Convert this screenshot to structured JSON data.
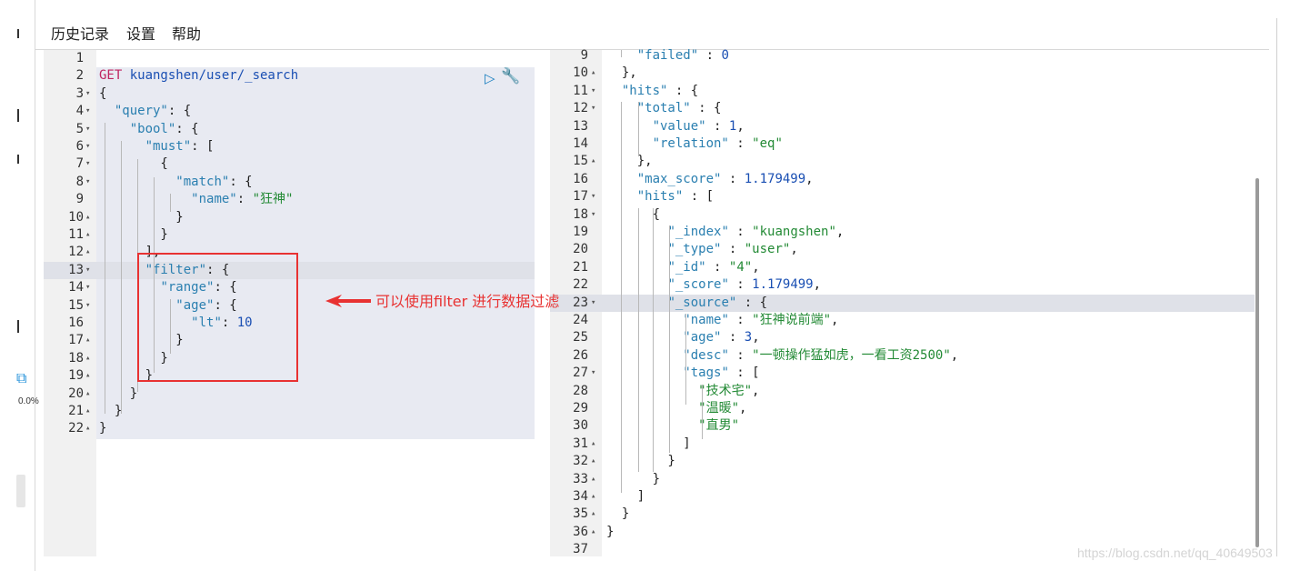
{
  "menu": {
    "history": "历史记录",
    "settings": "设置",
    "help": "帮助"
  },
  "left_status": {
    "percent": "0.0%"
  },
  "icons": {
    "run": "play-icon",
    "wrench": "wrench-icon",
    "close": "close-icon",
    "cube": "cube-icon"
  },
  "annotation": {
    "text": "可以使用filter 进行数据过滤",
    "color": "#e83232"
  },
  "request_lines": [
    {
      "n": "1",
      "f": "",
      "tokens": []
    },
    {
      "n": "2",
      "f": "",
      "tokens": [
        {
          "t": "GET ",
          "c": "m"
        },
        {
          "t": "kuangshen/user/_search",
          "c": "n"
        }
      ]
    },
    {
      "n": "3",
      "f": "▾",
      "tokens": [
        {
          "t": "{",
          "c": "p"
        }
      ]
    },
    {
      "n": "4",
      "f": "▾",
      "tokens": [
        {
          "t": "  ",
          "c": "p"
        },
        {
          "t": "\"query\"",
          "c": "k"
        },
        {
          "t": ": {",
          "c": "p"
        }
      ]
    },
    {
      "n": "5",
      "f": "▾",
      "tokens": [
        {
          "t": "    ",
          "c": "p"
        },
        {
          "t": "\"bool\"",
          "c": "k"
        },
        {
          "t": ": {",
          "c": "p"
        }
      ]
    },
    {
      "n": "6",
      "f": "▾",
      "tokens": [
        {
          "t": "      ",
          "c": "p"
        },
        {
          "t": "\"must\"",
          "c": "k"
        },
        {
          "t": ": [",
          "c": "p"
        }
      ]
    },
    {
      "n": "7",
      "f": "▾",
      "tokens": [
        {
          "t": "        {",
          "c": "p"
        }
      ]
    },
    {
      "n": "8",
      "f": "▾",
      "tokens": [
        {
          "t": "          ",
          "c": "p"
        },
        {
          "t": "\"match\"",
          "c": "k"
        },
        {
          "t": ": {",
          "c": "p"
        }
      ]
    },
    {
      "n": "9",
      "f": "",
      "tokens": [
        {
          "t": "            ",
          "c": "p"
        },
        {
          "t": "\"name\"",
          "c": "k"
        },
        {
          "t": ": ",
          "c": "p"
        },
        {
          "t": "\"狂神\"",
          "c": "s"
        }
      ]
    },
    {
      "n": "10",
      "f": "▴",
      "tokens": [
        {
          "t": "          }",
          "c": "p"
        }
      ]
    },
    {
      "n": "11",
      "f": "▴",
      "tokens": [
        {
          "t": "        }",
          "c": "p"
        }
      ]
    },
    {
      "n": "12",
      "f": "▴",
      "tokens": [
        {
          "t": "      ],",
          "c": "p"
        }
      ]
    },
    {
      "n": "13",
      "f": "▾",
      "tokens": [
        {
          "t": "      ",
          "c": "p"
        },
        {
          "t": "\"filter\"",
          "c": "k"
        },
        {
          "t": ": {",
          "c": "p"
        }
      ],
      "active": true
    },
    {
      "n": "14",
      "f": "▾",
      "tokens": [
        {
          "t": "        ",
          "c": "p"
        },
        {
          "t": "\"range\"",
          "c": "k"
        },
        {
          "t": ": {",
          "c": "p"
        }
      ]
    },
    {
      "n": "15",
      "f": "▾",
      "tokens": [
        {
          "t": "          ",
          "c": "p"
        },
        {
          "t": "\"age\"",
          "c": "k"
        },
        {
          "t": ": {",
          "c": "p"
        }
      ]
    },
    {
      "n": "16",
      "f": "",
      "tokens": [
        {
          "t": "            ",
          "c": "p"
        },
        {
          "t": "\"lt\"",
          "c": "k"
        },
        {
          "t": ": ",
          "c": "p"
        },
        {
          "t": "10",
          "c": "n"
        }
      ]
    },
    {
      "n": "17",
      "f": "▴",
      "tokens": [
        {
          "t": "          }",
          "c": "p"
        }
      ]
    },
    {
      "n": "18",
      "f": "▴",
      "tokens": [
        {
          "t": "        }",
          "c": "p"
        }
      ]
    },
    {
      "n": "19",
      "f": "▴",
      "tokens": [
        {
          "t": "      }",
          "c": "p"
        }
      ]
    },
    {
      "n": "20",
      "f": "▴",
      "tokens": [
        {
          "t": "    }",
          "c": "p"
        }
      ]
    },
    {
      "n": "21",
      "f": "▴",
      "tokens": [
        {
          "t": "  }",
          "c": "p"
        }
      ]
    },
    {
      "n": "22",
      "f": "▴",
      "tokens": [
        {
          "t": "}",
          "c": "p"
        }
      ]
    }
  ],
  "response_lines": [
    {
      "n": "9",
      "f": "",
      "tokens": [
        {
          "t": "    ",
          "c": "p"
        },
        {
          "t": "\"failed\"",
          "c": "k"
        },
        {
          "t": " : ",
          "c": "p"
        },
        {
          "t": "0",
          "c": "n"
        }
      ]
    },
    {
      "n": "10",
      "f": "▴",
      "tokens": [
        {
          "t": "  },",
          "c": "p"
        }
      ]
    },
    {
      "n": "11",
      "f": "▾",
      "tokens": [
        {
          "t": "  ",
          "c": "p"
        },
        {
          "t": "\"hits\"",
          "c": "k"
        },
        {
          "t": " : {",
          "c": "p"
        }
      ]
    },
    {
      "n": "12",
      "f": "▾",
      "tokens": [
        {
          "t": "    ",
          "c": "p"
        },
        {
          "t": "\"total\"",
          "c": "k"
        },
        {
          "t": " : {",
          "c": "p"
        }
      ]
    },
    {
      "n": "13",
      "f": "",
      "tokens": [
        {
          "t": "      ",
          "c": "p"
        },
        {
          "t": "\"value\"",
          "c": "k"
        },
        {
          "t": " : ",
          "c": "p"
        },
        {
          "t": "1",
          "c": "n"
        },
        {
          "t": ",",
          "c": "p"
        }
      ]
    },
    {
      "n": "14",
      "f": "",
      "tokens": [
        {
          "t": "      ",
          "c": "p"
        },
        {
          "t": "\"relation\"",
          "c": "k"
        },
        {
          "t": " : ",
          "c": "p"
        },
        {
          "t": "\"eq\"",
          "c": "s"
        }
      ]
    },
    {
      "n": "15",
      "f": "▴",
      "tokens": [
        {
          "t": "    },",
          "c": "p"
        }
      ]
    },
    {
      "n": "16",
      "f": "",
      "tokens": [
        {
          "t": "    ",
          "c": "p"
        },
        {
          "t": "\"max_score\"",
          "c": "k"
        },
        {
          "t": " : ",
          "c": "p"
        },
        {
          "t": "1.179499",
          "c": "n"
        },
        {
          "t": ",",
          "c": "p"
        }
      ]
    },
    {
      "n": "17",
      "f": "▾",
      "tokens": [
        {
          "t": "    ",
          "c": "p"
        },
        {
          "t": "\"hits\"",
          "c": "k"
        },
        {
          "t": " : [",
          "c": "p"
        }
      ]
    },
    {
      "n": "18",
      "f": "▾",
      "tokens": [
        {
          "t": "      {",
          "c": "p"
        }
      ]
    },
    {
      "n": "19",
      "f": "",
      "tokens": [
        {
          "t": "        ",
          "c": "p"
        },
        {
          "t": "\"_index\"",
          "c": "k"
        },
        {
          "t": " : ",
          "c": "p"
        },
        {
          "t": "\"kuangshen\"",
          "c": "s"
        },
        {
          "t": ",",
          "c": "p"
        }
      ]
    },
    {
      "n": "20",
      "f": "",
      "tokens": [
        {
          "t": "        ",
          "c": "p"
        },
        {
          "t": "\"_type\"",
          "c": "k"
        },
        {
          "t": " : ",
          "c": "p"
        },
        {
          "t": "\"user\"",
          "c": "s"
        },
        {
          "t": ",",
          "c": "p"
        }
      ]
    },
    {
      "n": "21",
      "f": "",
      "tokens": [
        {
          "t": "        ",
          "c": "p"
        },
        {
          "t": "\"_id\"",
          "c": "k"
        },
        {
          "t": " : ",
          "c": "p"
        },
        {
          "t": "\"4\"",
          "c": "s"
        },
        {
          "t": ",",
          "c": "p"
        }
      ]
    },
    {
      "n": "22",
      "f": "",
      "tokens": [
        {
          "t": "        ",
          "c": "p"
        },
        {
          "t": "\"_score\"",
          "c": "k"
        },
        {
          "t": " : ",
          "c": "p"
        },
        {
          "t": "1.179499",
          "c": "n"
        },
        {
          "t": ",",
          "c": "p"
        }
      ]
    },
    {
      "n": "23",
      "f": "▾",
      "tokens": [
        {
          "t": "        ",
          "c": "p"
        },
        {
          "t": "\"_source\"",
          "c": "k"
        },
        {
          "t": " : {",
          "c": "p"
        }
      ],
      "active": true
    },
    {
      "n": "24",
      "f": "",
      "tokens": [
        {
          "t": "          ",
          "c": "p"
        },
        {
          "t": "\"name\"",
          "c": "k"
        },
        {
          "t": " : ",
          "c": "p"
        },
        {
          "t": "\"狂神说前端\"",
          "c": "s"
        },
        {
          "t": ",",
          "c": "p"
        }
      ]
    },
    {
      "n": "25",
      "f": "",
      "tokens": [
        {
          "t": "          ",
          "c": "p"
        },
        {
          "t": "\"age\"",
          "c": "k"
        },
        {
          "t": " : ",
          "c": "p"
        },
        {
          "t": "3",
          "c": "n"
        },
        {
          "t": ",",
          "c": "p"
        }
      ]
    },
    {
      "n": "26",
      "f": "",
      "tokens": [
        {
          "t": "          ",
          "c": "p"
        },
        {
          "t": "\"desc\"",
          "c": "k"
        },
        {
          "t": " : ",
          "c": "p"
        },
        {
          "t": "\"一顿操作猛如虎，一看工资2500\"",
          "c": "s"
        },
        {
          "t": ",",
          "c": "p"
        }
      ]
    },
    {
      "n": "27",
      "f": "▾",
      "tokens": [
        {
          "t": "          ",
          "c": "p"
        },
        {
          "t": "\"tags\"",
          "c": "k"
        },
        {
          "t": " : [",
          "c": "p"
        }
      ]
    },
    {
      "n": "28",
      "f": "",
      "tokens": [
        {
          "t": "            ",
          "c": "p"
        },
        {
          "t": "\"技术宅\"",
          "c": "s"
        },
        {
          "t": ",",
          "c": "p"
        }
      ]
    },
    {
      "n": "29",
      "f": "",
      "tokens": [
        {
          "t": "            ",
          "c": "p"
        },
        {
          "t": "\"温暖\"",
          "c": "s"
        },
        {
          "t": ",",
          "c": "p"
        }
      ]
    },
    {
      "n": "30",
      "f": "",
      "tokens": [
        {
          "t": "            ",
          "c": "p"
        },
        {
          "t": "\"直男\"",
          "c": "s"
        }
      ]
    },
    {
      "n": "31",
      "f": "▴",
      "tokens": [
        {
          "t": "          ]",
          "c": "p"
        }
      ]
    },
    {
      "n": "32",
      "f": "▴",
      "tokens": [
        {
          "t": "        }",
          "c": "p"
        }
      ]
    },
    {
      "n": "33",
      "f": "▴",
      "tokens": [
        {
          "t": "      }",
          "c": "p"
        }
      ]
    },
    {
      "n": "34",
      "f": "▴",
      "tokens": [
        {
          "t": "    ]",
          "c": "p"
        }
      ]
    },
    {
      "n": "35",
      "f": "▴",
      "tokens": [
        {
          "t": "  }",
          "c": "p"
        }
      ]
    },
    {
      "n": "36",
      "f": "▴",
      "tokens": [
        {
          "t": "}",
          "c": "p"
        }
      ]
    },
    {
      "n": "37",
      "f": "",
      "tokens": []
    }
  ],
  "watermark": "https://blog.csdn.net/qq_40649503"
}
